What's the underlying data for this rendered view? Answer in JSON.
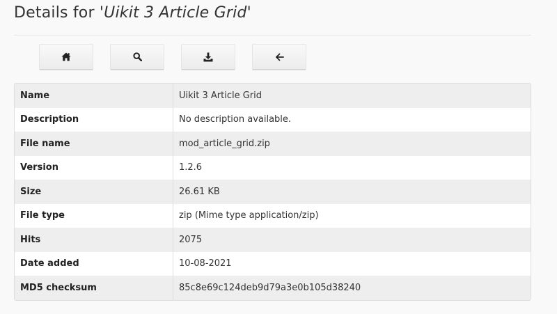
{
  "header": {
    "title_prefix": "Details for ",
    "title_name": "'Uikit 3 Article Grid'"
  },
  "toolbar": {
    "buttons": [
      {
        "icon": "home-icon"
      },
      {
        "icon": "search-icon"
      },
      {
        "icon": "download-icon"
      },
      {
        "icon": "arrow-left-icon"
      }
    ]
  },
  "details": {
    "rows": [
      {
        "label": "Name",
        "value": "Uikit 3 Article Grid"
      },
      {
        "label": "Description",
        "value": "No description available."
      },
      {
        "label": "File name",
        "value": "mod_article_grid.zip"
      },
      {
        "label": "Version",
        "value": "1.2.6"
      },
      {
        "label": "Size",
        "value": "26.61 KB"
      },
      {
        "label": "File type",
        "value": "zip (Mime type application/zip)"
      },
      {
        "label": "Hits",
        "value": "2075"
      },
      {
        "label": "Date added",
        "value": "10-08-2021"
      },
      {
        "label": "MD5 checksum",
        "value": "85c8e69c124deb9d79a3e0b105d38240"
      }
    ]
  },
  "colors": {
    "icon": "#222222",
    "row_alt": "#eeeeee",
    "border": "#dddddd"
  }
}
